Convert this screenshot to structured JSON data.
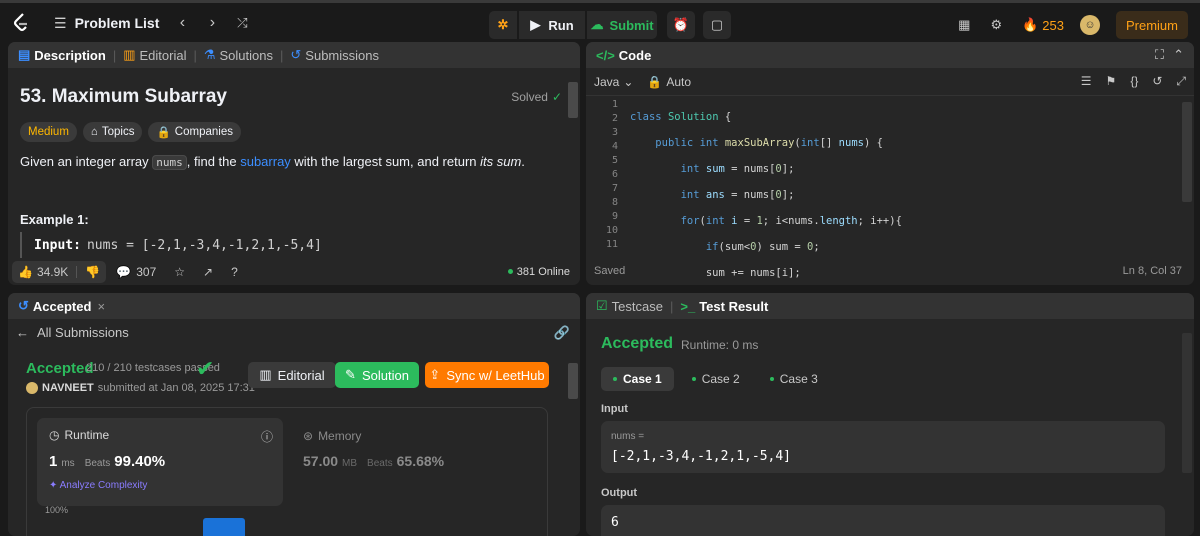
{
  "topbar": {
    "problem_list": "Problem List",
    "run": "Run",
    "submit": "Submit",
    "streak": "253",
    "premium": "Premium"
  },
  "desc": {
    "tabs": [
      "Description",
      "Editorial",
      "Solutions",
      "Submissions"
    ],
    "title": "53. Maximum Subarray",
    "solved": "Solved",
    "difficulty": "Medium",
    "topics": "Topics",
    "companies": "Companies",
    "stmt_a": "Given an integer array ",
    "stmt_code": "nums",
    "stmt_b": ", find the ",
    "stmt_link": "subarray",
    "stmt_c": " with the largest sum, and return ",
    "stmt_em": "its sum",
    "stmt_d": ".",
    "example_title": "Example 1:",
    "input_label": "Input:",
    "input_value": "nums = [-2,1,-3,4,-1,2,1,-5,4]",
    "likes": "34.9K",
    "comments": "307",
    "online": "381 Online"
  },
  "code": {
    "tab": "Code",
    "lang": "Java",
    "auto": "Auto",
    "saved": "Saved",
    "pos": "Ln 8, Col 37",
    "line_numbers": [
      "1",
      "2",
      "3",
      "4",
      "5",
      "6",
      "7",
      "8",
      "9",
      "10",
      "11"
    ]
  },
  "accepted": {
    "tab": "Accepted",
    "back": "All Submissions",
    "status": "Accepted",
    "passed": "210 / 210 testcases passed",
    "user": "NAVNEET",
    "submitted": "submitted at Jan 08, 2025 17:31",
    "editorial": "Editorial",
    "solution": "Solution",
    "sync": "Sync w/ LeetHub",
    "runtime_label": "Runtime",
    "runtime_val": "1",
    "runtime_unit": "ms",
    "beats_label": "Beats",
    "runtime_beats": "99.40%",
    "analyze": "Analyze Complexity",
    "memory_label": "Memory",
    "memory_val": "57.00",
    "memory_unit": "MB",
    "memory_beats": "65.68%",
    "axis_top": "100%"
  },
  "test": {
    "tab_testcase": "Testcase",
    "tab_result": "Test Result",
    "status": "Accepted",
    "runtime": "Runtime: 0 ms",
    "cases": [
      "Case 1",
      "Case 2",
      "Case 3"
    ],
    "input_label": "Input",
    "var": "nums =",
    "input_value": "[-2,1,-3,4,-1,2,1,-5,4]",
    "output_label": "Output",
    "output_value": "6"
  }
}
